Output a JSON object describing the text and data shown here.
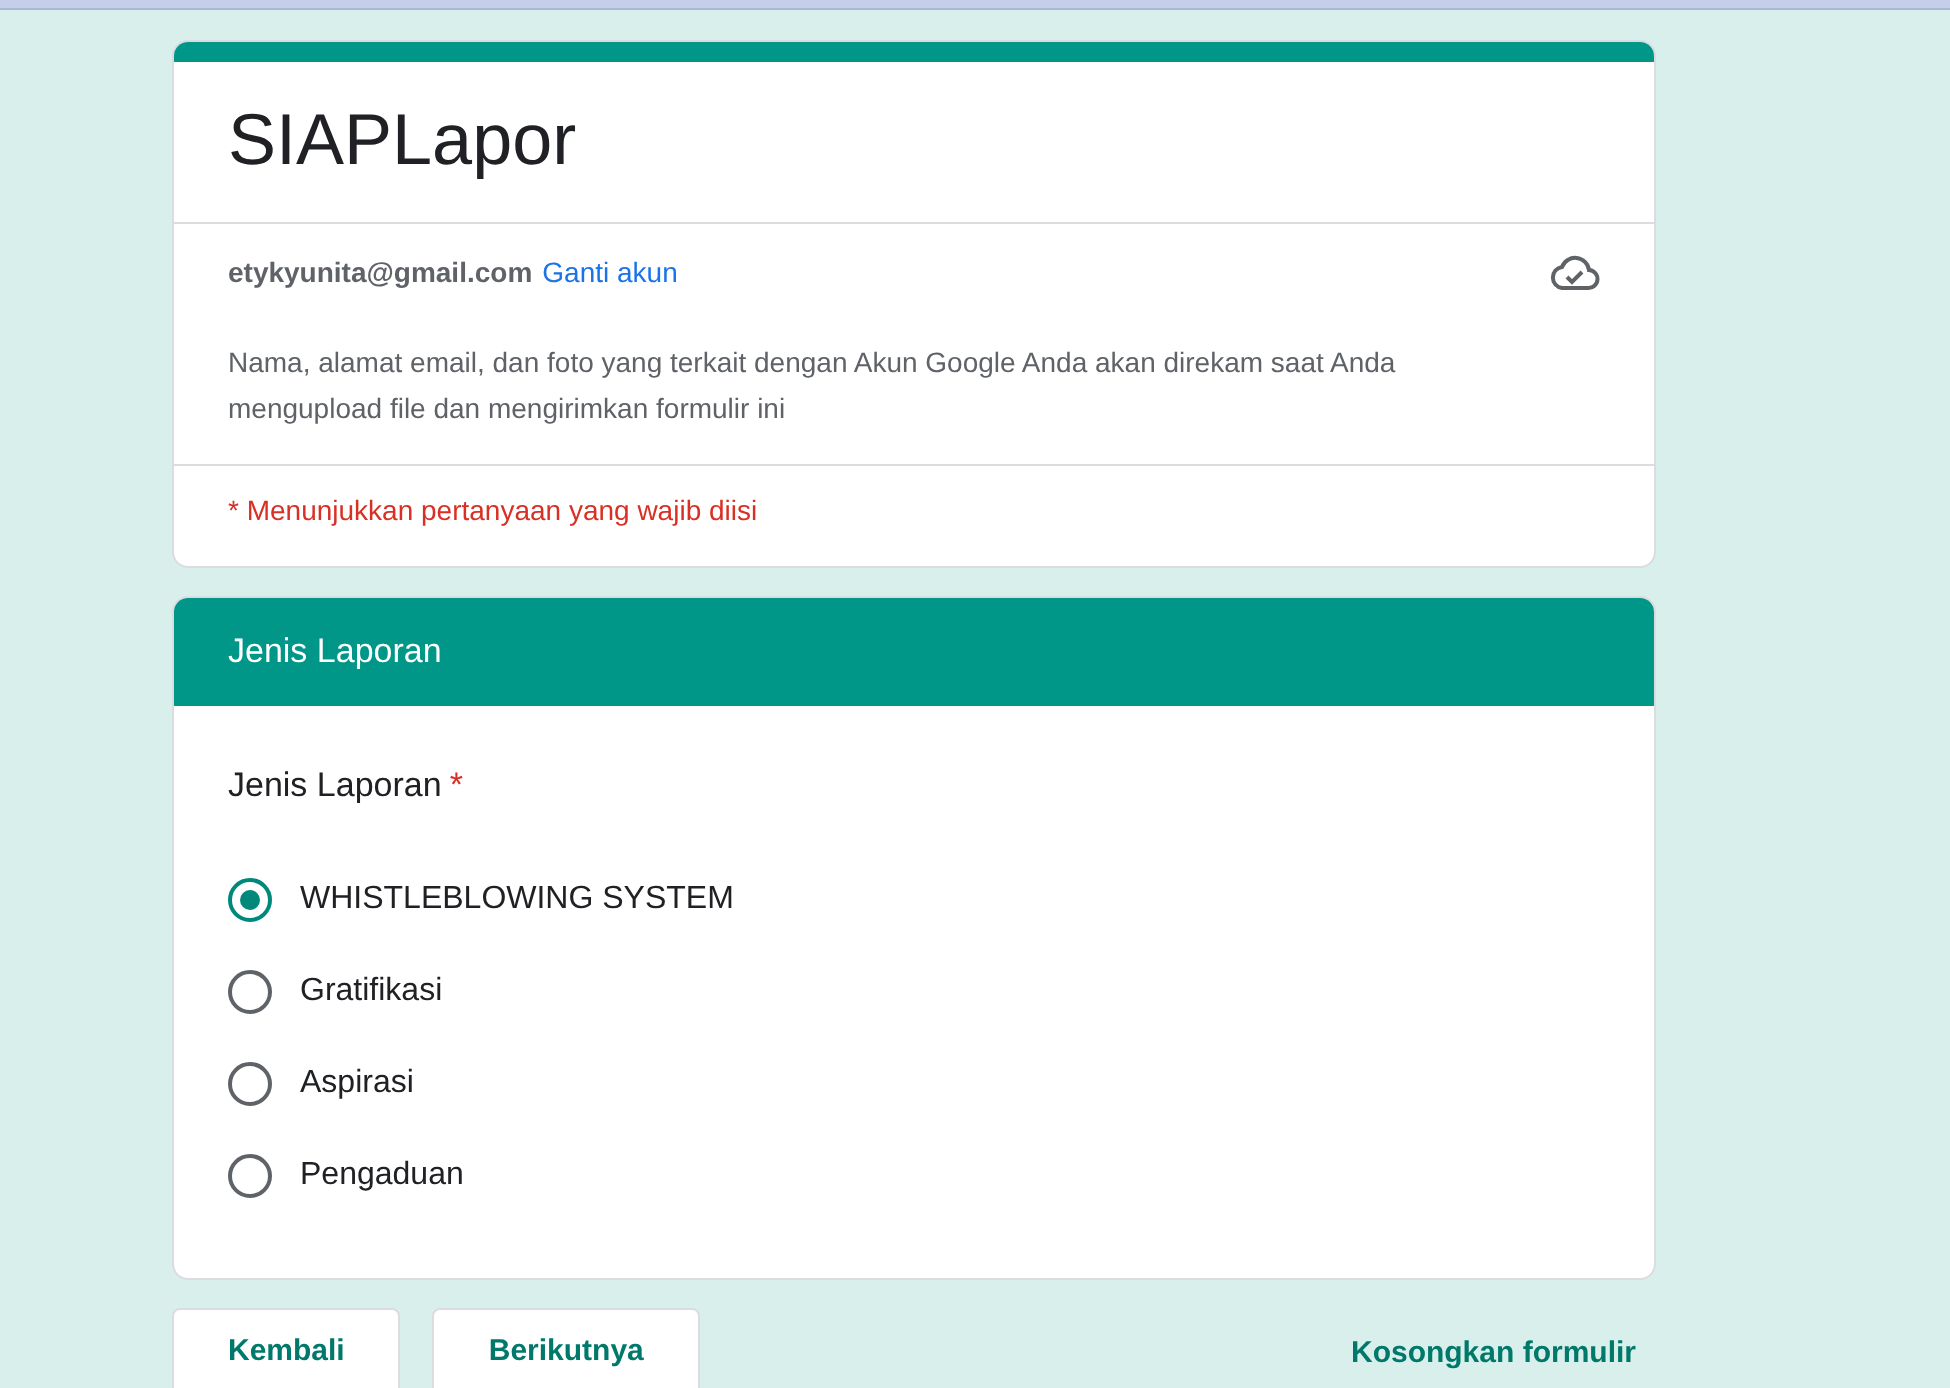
{
  "form": {
    "title": "SIAPLapor",
    "account_email": "etykyunita@gmail.com",
    "switch_account": "Ganti akun",
    "notice": "Nama, alamat email, dan foto yang terkait dengan Akun Google Anda akan direkam saat Anda mengupload file dan mengirimkan formulir ini",
    "required_note": "* Menunjukkan pertanyaan yang wajib diisi"
  },
  "section": {
    "title": "Jenis Laporan",
    "question": {
      "label": "Jenis Laporan",
      "required": true,
      "required_mark": "*",
      "options": [
        {
          "label": "WHISTLEBLOWING SYSTEM",
          "selected": true
        },
        {
          "label": "Gratifikasi",
          "selected": false
        },
        {
          "label": "Aspirasi",
          "selected": false
        },
        {
          "label": "Pengaduan",
          "selected": false
        }
      ]
    }
  },
  "buttons": {
    "back": "Kembali",
    "next": "Berikutnya",
    "clear": "Kosongkan formulir"
  }
}
